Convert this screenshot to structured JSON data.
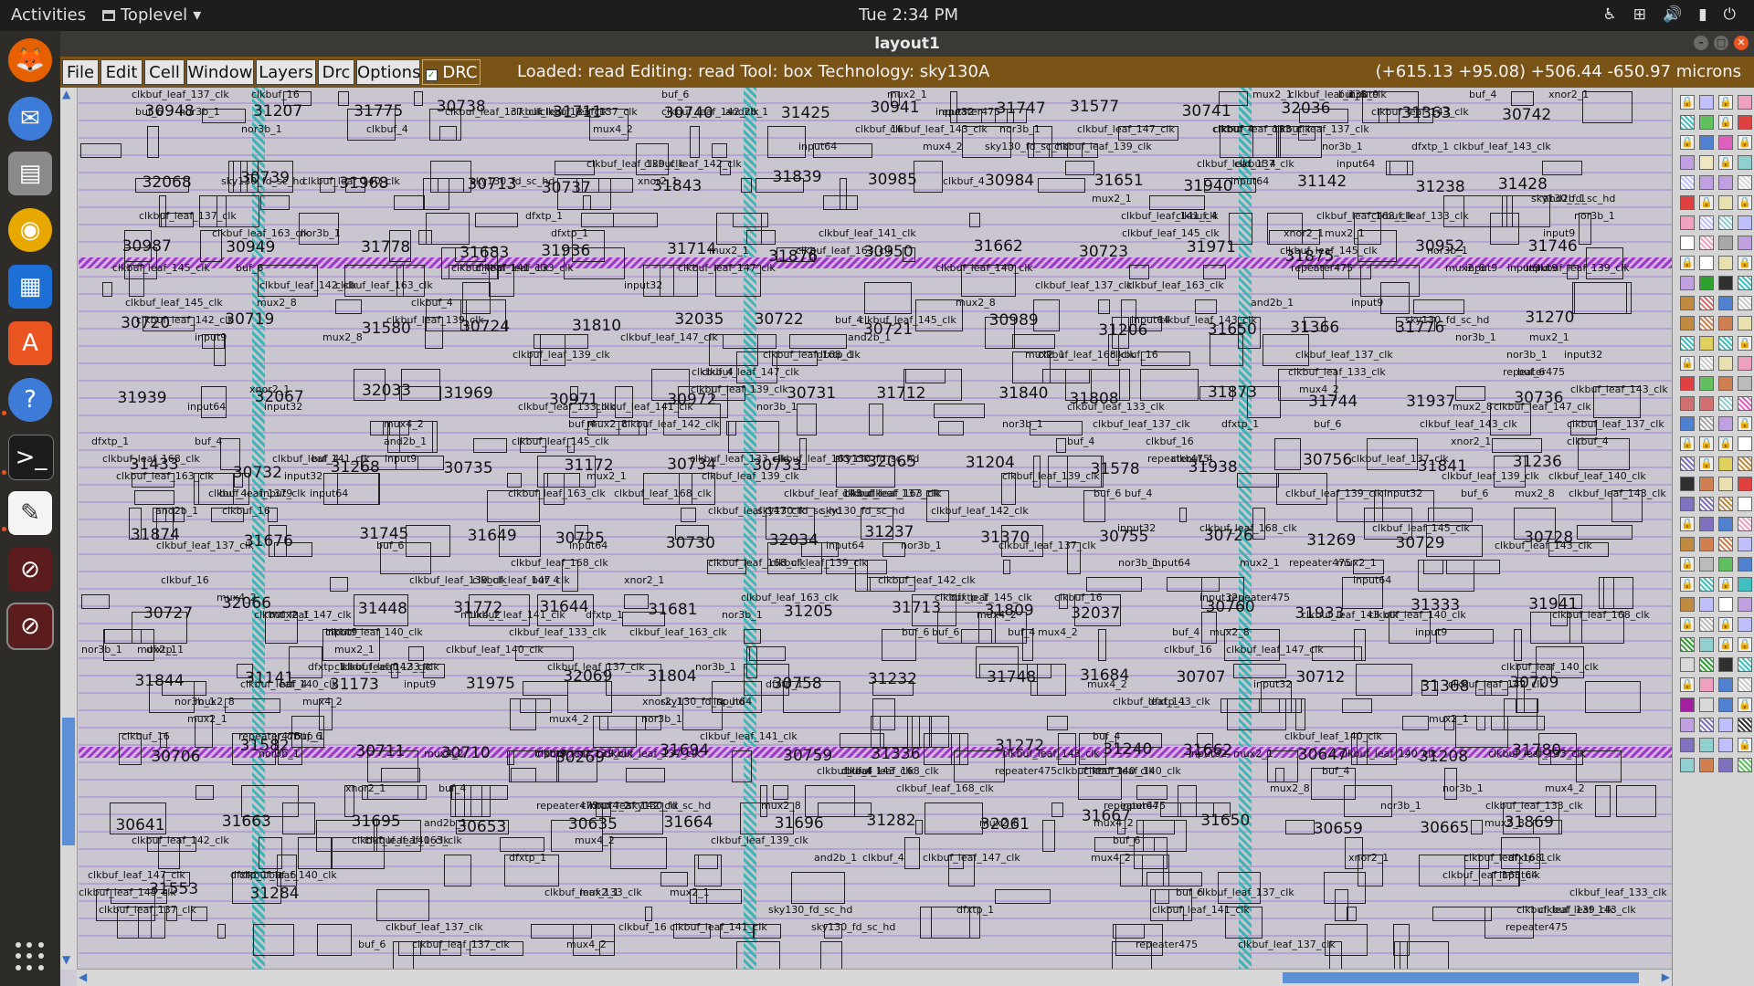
{
  "topbar": {
    "activities": "Activities",
    "app_name": "Toplevel",
    "clock": "Tue  2:34 PM"
  },
  "window": {
    "title": "layout1"
  },
  "menubar": {
    "items": [
      "File",
      "Edit",
      "Cell",
      "Window",
      "Layers",
      "Drc",
      "Options"
    ],
    "drc_label": "DRC",
    "status": "Loaded: read Editing: read Tool: box  Technology: sky130A",
    "coords": "(+615.13 +95.08) +506.44 -650.97 microns"
  },
  "layout": {
    "big_labels": [
      "30948",
      "31207",
      "31775",
      "30738",
      "31711",
      "30740",
      "31425",
      "30941",
      "31747",
      "31577",
      "30741",
      "32036",
      "31363",
      "30742",
      "32068",
      "30739",
      "31968",
      "30713",
      "30737",
      "31843",
      "31839",
      "30985",
      "30984",
      "31651",
      "31940",
      "31142",
      "31238",
      "31428",
      "30987",
      "30949",
      "31778",
      "31683",
      "31936",
      "31714",
      "31876",
      "30950",
      "31662",
      "30723",
      "31971",
      "31875",
      "30952",
      "31746",
      "30720",
      "30719",
      "31580",
      "30724",
      "31810",
      "32035",
      "30722",
      "30721",
      "30989",
      "31206",
      "31650",
      "31366",
      "31776",
      "31270",
      "31939",
      "32067",
      "32033",
      "31969",
      "30971",
      "30972",
      "30731",
      "31712",
      "31840",
      "31808",
      "31873",
      "31744",
      "31937",
      "30736",
      "31433",
      "30732",
      "31268",
      "30735",
      "31172",
      "30734",
      "30733",
      "32065",
      "31204",
      "31578",
      "31938",
      "30756",
      "31841",
      "31236",
      "31874",
      "31676",
      "31745",
      "31649",
      "30725",
      "30730",
      "32034",
      "31237",
      "31370",
      "30755",
      "30726",
      "31269",
      "30729",
      "30728",
      "30727",
      "32066",
      "31448",
      "31772",
      "31644",
      "31681",
      "31205",
      "31713",
      "31809",
      "32037",
      "30760",
      "31933",
      "31333",
      "31941",
      "31844",
      "31141",
      "31173",
      "31975",
      "32069",
      "31804",
      "30758",
      "31232",
      "31748",
      "31684",
      "30707",
      "30712",
      "31368",
      "30709",
      "30706",
      "31582",
      "30711",
      "30710",
      "30269",
      "31694",
      "30759",
      "31336",
      "31272",
      "31240",
      "31662",
      "30647",
      "31208",
      "31780",
      "30641",
      "31663",
      "31695",
      "30653",
      "30635",
      "31664",
      "31696",
      "31282",
      "32061",
      "31667",
      "31650",
      "30659",
      "30665",
      "31869",
      "31553",
      "31284"
    ],
    "small_labels": [
      "sky130_fd_sc_hd",
      "dfxtp_1",
      "mux2_1",
      "clkbuf_16",
      "mux4_2",
      "xnor2_1",
      "and2b_1",
      "nor3b_1",
      "clkbuf_4",
      "repeater475",
      "input9",
      "input64",
      "input32",
      "buf_6",
      "buf_4",
      "clkbuf_leaf_137_clk",
      "clkbuf_leaf_133_clk",
      "clkbuf_leaf_139_clk",
      "clkbuf_leaf_140_clk",
      "clkbuf_leaf_145_clk",
      "clkbuf_leaf_143_clk",
      "clkbuf_leaf_141_clk",
      "clkbuf_leaf_142_clk",
      "clkbuf_leaf_163_clk",
      "clkbuf_leaf_147_clk",
      "clkbuf_leaf_168_clk",
      "mux2_8"
    ]
  }
}
